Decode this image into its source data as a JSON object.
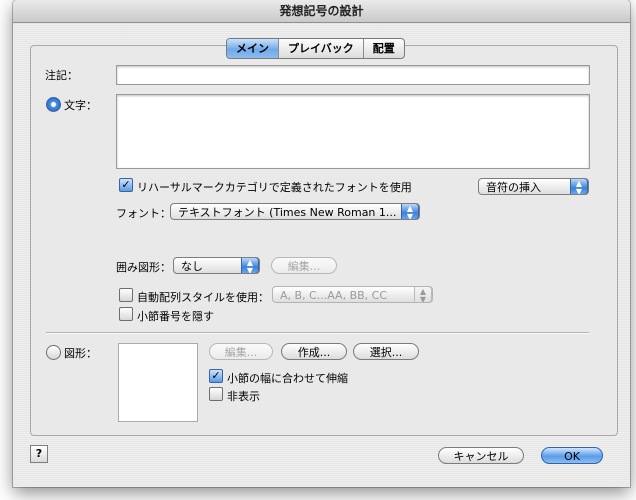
{
  "window": {
    "title": "発想記号の設計"
  },
  "tabs": [
    {
      "label": "メイン",
      "active": true
    },
    {
      "label": "プレイバック",
      "active": false
    },
    {
      "label": "配置",
      "active": false
    }
  ],
  "main": {
    "annotation_label": "注記：",
    "annotation_value": "",
    "text_radio_label": "文字：",
    "text_value": "",
    "use_font_checkbox_label": "リハーサルマークカテゴリで定義されたフォントを使用",
    "insert_note_popup": "音符の挿入",
    "font_label": "フォント：",
    "font_popup_value": "テキストフォント (Times New Roman 1...",
    "enclosure_label": "囲み図形：",
    "enclosure_popup_value": "なし",
    "edit_enclosure_button": "編集...",
    "auto_sequence_checkbox_label": "自動配列スタイルを使用：",
    "auto_sequence_popup_value": "A, B, C...AA, BB, CC",
    "hide_measure_checkbox_label": "小節番号を隠す",
    "shape_radio_label": "図形：",
    "shape_edit_button": "編集...",
    "shape_create_button": "作成...",
    "shape_select_button": "選択...",
    "fit_measure_checkbox_label": "小節の幅に合わせて伸縮",
    "hide_checkbox_label": "非表示"
  },
  "footer": {
    "help_label": "?",
    "cancel_button": "キャンセル",
    "ok_button": "OK"
  },
  "colors": {
    "accent_blue": "#5b9ce9",
    "window_bg": "#e8e8e8"
  }
}
